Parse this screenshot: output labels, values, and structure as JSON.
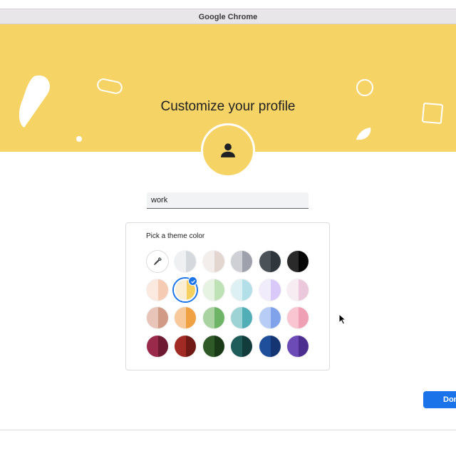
{
  "window": {
    "title": "Google Chrome"
  },
  "banner": {
    "title": "Customize your profile",
    "color": "#f6d365"
  },
  "profile": {
    "name_value": "work",
    "avatar_icon": "person-icon"
  },
  "theme_picker": {
    "label": "Pick a theme color",
    "selected_index": 7,
    "custom_picker_icon": "eyedropper-icon",
    "swatches": [
      {
        "name": "custom",
        "left": "#ffffff",
        "right": "#ffffff"
      },
      {
        "name": "grey-light",
        "left": "#eef0f1",
        "right": "#d5d8dc"
      },
      {
        "name": "beige-light",
        "left": "#f3eeec",
        "right": "#e3d6d0"
      },
      {
        "name": "grey",
        "left": "#cfd0d5",
        "right": "#9ea1ab"
      },
      {
        "name": "charcoal",
        "left": "#4a5258",
        "right": "#2f363c"
      },
      {
        "name": "black",
        "left": "#2a2a2a",
        "right": "#060606"
      },
      {
        "name": "peach-light",
        "left": "#fbe9e0",
        "right": "#f6cbb3"
      },
      {
        "name": "yellow-light",
        "left": "#fbeed5",
        "right": "#f6d05f"
      },
      {
        "name": "green-light",
        "left": "#e6f3e2",
        "right": "#bfe1b6"
      },
      {
        "name": "cyan-light",
        "left": "#ddf1f4",
        "right": "#b3e0e8"
      },
      {
        "name": "lavender-light",
        "left": "#f1ecfb",
        "right": "#d9c9f8"
      },
      {
        "name": "pink-light",
        "left": "#f8ecf3",
        "right": "#ecc8dc"
      },
      {
        "name": "rose",
        "left": "#e7c3b8",
        "right": "#d09a86"
      },
      {
        "name": "orange",
        "left": "#f8c99a",
        "right": "#f0a142"
      },
      {
        "name": "green",
        "left": "#a9d4a2",
        "right": "#6db466"
      },
      {
        "name": "teal",
        "left": "#9ed3d6",
        "right": "#51aeb7"
      },
      {
        "name": "blue",
        "left": "#b8cdf6",
        "right": "#7fa2ea"
      },
      {
        "name": "pink",
        "left": "#f8c5d0",
        "right": "#f0a0b4"
      },
      {
        "name": "burgundy",
        "left": "#9a2a4b",
        "right": "#6e1a33"
      },
      {
        "name": "red",
        "left": "#a12a24",
        "right": "#711a15"
      },
      {
        "name": "forest",
        "left": "#2f5a28",
        "right": "#1a3a17"
      },
      {
        "name": "dark-teal",
        "left": "#1f5d5b",
        "right": "#113c3b"
      },
      {
        "name": "navy",
        "left": "#1f4f9a",
        "right": "#143472"
      },
      {
        "name": "purple",
        "left": "#6d4bb6",
        "right": "#4c2e8e"
      }
    ]
  },
  "actions": {
    "done_label": "Done",
    "accent": "#1a73e8"
  }
}
